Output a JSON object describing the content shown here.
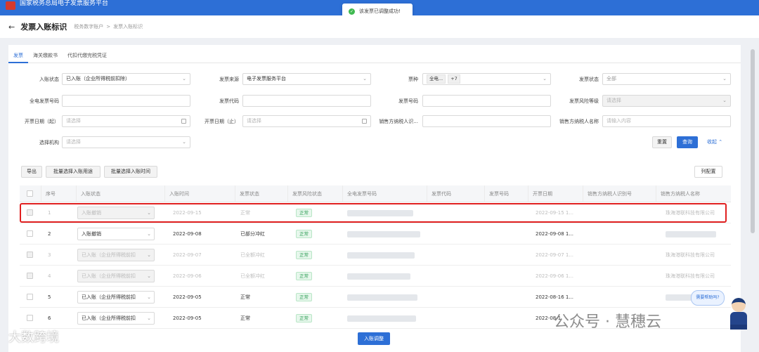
{
  "app": {
    "title": "国家税务总局电子发票服务平台"
  },
  "toast": {
    "message": "该发票已调整成功!"
  },
  "header": {
    "title": "发票入账标识",
    "breadcrumb": [
      "税务数字账户",
      "发票入账标识"
    ],
    "breadcrumb_sep": ">"
  },
  "tabs": [
    "发票",
    "海关缴款书",
    "代扣代缴完税凭证"
  ],
  "filters": {
    "entry_status": {
      "label": "入账状态",
      "value": "已入账（企业所得税前扣除）"
    },
    "invoice_source": {
      "label": "发票来源",
      "value": "电子发票服务平台"
    },
    "invoice_kind": {
      "label": "票种",
      "chip": "全电...",
      "more": "+7"
    },
    "invoice_status": {
      "label": "发票状态",
      "value": "全部"
    },
    "full_elec_no": {
      "label": "全电发票号码",
      "value": ""
    },
    "invoice_code": {
      "label": "发票代码",
      "value": ""
    },
    "invoice_no": {
      "label": "发票号码",
      "value": ""
    },
    "risk_level": {
      "label": "发票风险等级",
      "placeholder": "请选择"
    },
    "date_start": {
      "label": "开票日期（起）",
      "placeholder": "请选择"
    },
    "date_end": {
      "label": "开票日期（止）",
      "placeholder": "请选择"
    },
    "seller_id": {
      "label": "销售方纳税人识...",
      "value": ""
    },
    "seller_name": {
      "label": "销售方纳税人名称",
      "placeholder": "请输入内容"
    },
    "org": {
      "label": "选择机构",
      "placeholder": "请选择"
    }
  },
  "buttons": {
    "reset": "重置",
    "query": "查询",
    "collapse": "收起",
    "export": "导出",
    "batch_use": "批量选择入账用途",
    "batch_time": "批量选择入账时间",
    "columns": "列配置",
    "adjust": "入账调整"
  },
  "table": {
    "columns": [
      "序号",
      "入账状态",
      "入账时间",
      "发票状态",
      "发票风险状态",
      "全电发票号码",
      "发票代码",
      "发票号码",
      "开票日期",
      "销售方纳税人识别号",
      "销售方纳税人名称"
    ],
    "rows": [
      {
        "no": "1",
        "entry": "入账撤销",
        "time": "2022-09-15",
        "status": "正常",
        "risk": "正常",
        "date": "2022-09-15 1...",
        "seller": "珠海港联科技有限公司",
        "dim": true
      },
      {
        "no": "2",
        "entry": "入账撤销",
        "time": "2022-09-08",
        "status": "已部分冲红",
        "risk": "正常",
        "date": "2022-09-08 1...",
        "seller": "",
        "dim": false
      },
      {
        "no": "3",
        "entry": "已入账（企业所得税前扣",
        "time": "2022-09-07",
        "status": "已全额冲红",
        "risk": "正常",
        "date": "2022-09-07 1...",
        "seller": "珠海港联科技有限公司",
        "dim": true
      },
      {
        "no": "4",
        "entry": "已入账（企业所得税前扣",
        "time": "2022-09-06",
        "status": "已全额冲红",
        "risk": "正常",
        "date": "2022-09-06 1...",
        "seller": "珠海港联科技有限公司",
        "dim": true
      },
      {
        "no": "5",
        "entry": "已入账（企业所得税前扣",
        "time": "2022-09-05",
        "status": "正常",
        "risk": "正常",
        "date": "2022-08-16 1...",
        "seller": "",
        "dim": false
      },
      {
        "no": "6",
        "entry": "已入账（企业所得税前扣",
        "time": "2022-09-05",
        "status": "正常",
        "risk": "正常",
        "date": "2022-08-1",
        "seller": "",
        "dim": false
      }
    ]
  },
  "assistant": {
    "bubble": "需要帮助吗?"
  },
  "watermarks": {
    "left": "大数跨境",
    "right": "公众号 · 慧穗云"
  },
  "colors": {
    "primary": "#2d6fd6",
    "highlight": "#e02020",
    "risk_ok": "#2e9e55"
  }
}
